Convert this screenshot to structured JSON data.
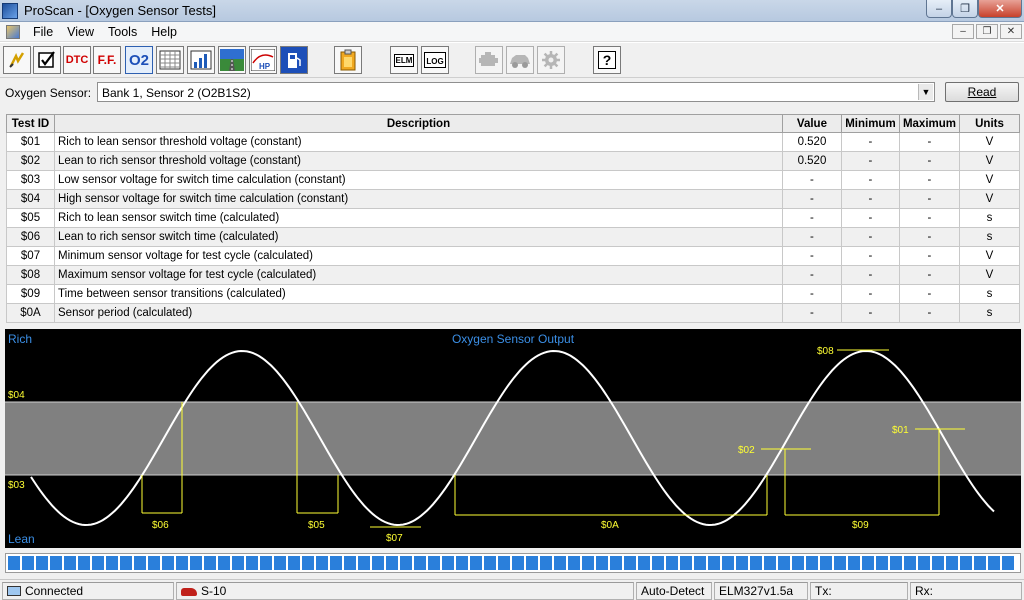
{
  "window": {
    "title": "ProScan - [Oxygen Sensor Tests]"
  },
  "menu": {
    "items": [
      "File",
      "View",
      "Tools",
      "Help"
    ]
  },
  "toolbar": {
    "buttons": [
      {
        "icon": "connect-icon"
      },
      {
        "icon": "checklist-icon"
      },
      {
        "icon": "dtc-icon",
        "label": "DTC"
      },
      {
        "icon": "freeze-frame-icon",
        "label": "F.F."
      },
      {
        "icon": "o2-sensor-icon",
        "label": "O2"
      },
      {
        "icon": "grid-icon"
      },
      {
        "icon": "bar-chart-icon"
      },
      {
        "icon": "road-icon"
      },
      {
        "icon": "hp-icon",
        "label": "HP"
      },
      {
        "icon": "fuel-icon"
      },
      {
        "icon": "clipboard-icon"
      },
      {
        "icon": "elm-icon",
        "label": "ELM"
      },
      {
        "icon": "log-icon",
        "label": "LOG"
      },
      {
        "icon": "engine-icon"
      },
      {
        "icon": "car-icon"
      },
      {
        "icon": "gear-icon"
      },
      {
        "icon": "help-icon",
        "label": "?"
      }
    ]
  },
  "sensor": {
    "label": "Oxygen Sensor:",
    "value": "Bank 1, Sensor 2 (O2B1S2)",
    "read_button": "Read"
  },
  "table": {
    "headers": [
      "Test ID",
      "Description",
      "Value",
      "Minimum",
      "Maximum",
      "Units"
    ],
    "rows": [
      {
        "id": "$01",
        "desc": "Rich to lean sensor threshold voltage (constant)",
        "value": "0.520",
        "min": "-",
        "max": "-",
        "unit": "V"
      },
      {
        "id": "$02",
        "desc": "Lean to rich sensor threshold voltage (constant)",
        "value": "0.520",
        "min": "-",
        "max": "-",
        "unit": "V"
      },
      {
        "id": "$03",
        "desc": "Low sensor voltage for switch time calculation (constant)",
        "value": "-",
        "min": "-",
        "max": "-",
        "unit": "V"
      },
      {
        "id": "$04",
        "desc": "High sensor voltage for switch time calculation (constant)",
        "value": "-",
        "min": "-",
        "max": "-",
        "unit": "V"
      },
      {
        "id": "$05",
        "desc": "Rich to lean sensor switch time (calculated)",
        "value": "-",
        "min": "-",
        "max": "-",
        "unit": "s"
      },
      {
        "id": "$06",
        "desc": "Lean to rich sensor switch time (calculated)",
        "value": "-",
        "min": "-",
        "max": "-",
        "unit": "s"
      },
      {
        "id": "$07",
        "desc": "Minimum sensor voltage for test cycle (calculated)",
        "value": "-",
        "min": "-",
        "max": "-",
        "unit": "V"
      },
      {
        "id": "$08",
        "desc": "Maximum sensor voltage for test cycle (calculated)",
        "value": "-",
        "min": "-",
        "max": "-",
        "unit": "V"
      },
      {
        "id": "$09",
        "desc": "Time between sensor transitions (calculated)",
        "value": "-",
        "min": "-",
        "max": "-",
        "unit": "s"
      },
      {
        "id": "$0A",
        "desc": "Sensor period (calculated)",
        "value": "-",
        "min": "-",
        "max": "-",
        "unit": "s"
      }
    ]
  },
  "graph": {
    "title": "Oxygen Sensor Output",
    "rich_label": "Rich",
    "lean_label": "Lean",
    "level_labels": {
      "high": "$04",
      "low": "$03"
    },
    "markers": [
      "$01",
      "$02",
      "$08",
      "$06",
      "$05",
      "$07",
      "$0A",
      "$09"
    ],
    "colors": {
      "background": "#000000",
      "band": "#808080",
      "curve": "#ffffff",
      "annotation": "#ffff33",
      "title": "#3b8fe6"
    }
  },
  "progress": {
    "fraction": 1.0
  },
  "status": {
    "connection": "Connected",
    "vehicle": "S-10",
    "protocol": "Auto-Detect",
    "interface": "ELM327v1.5a",
    "tx": "Tx:",
    "rx": "Rx:"
  }
}
